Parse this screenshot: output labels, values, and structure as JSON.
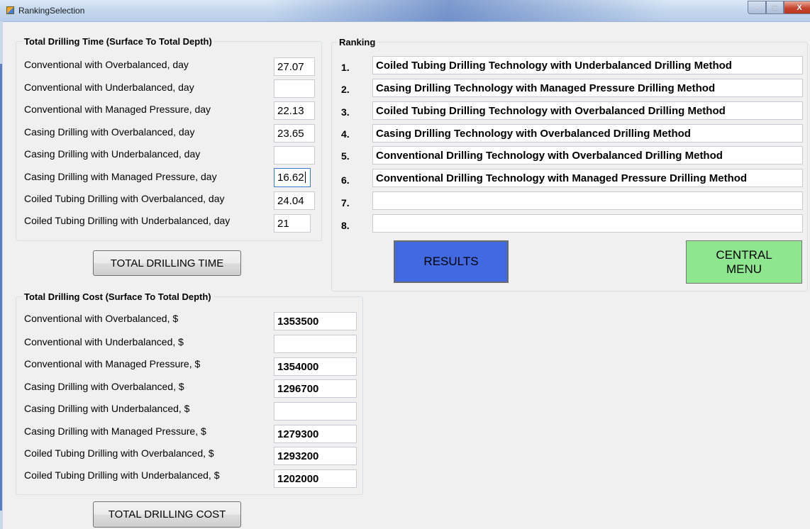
{
  "window": {
    "title": "RankingSelection",
    "minimize_glyph": "–",
    "maximize_glyph": "□",
    "close_glyph": "X"
  },
  "time_group": {
    "title": "Total Drilling Time (Surface To Total Depth)",
    "rows": [
      {
        "label": "Conventional with Overbalanced, day",
        "value": "27.07"
      },
      {
        "label": "Conventional with Underbalanced, day",
        "value": ""
      },
      {
        "label": "Conventional with Managed Pressure, day",
        "value": "22.13"
      },
      {
        "label": "Casing Drilling with Overbalanced, day",
        "value": "23.65"
      },
      {
        "label": "Casing Drilling with Underbalanced, day",
        "value": ""
      },
      {
        "label": "Casing Drilling with Managed Pressure, day",
        "value": "16.62"
      },
      {
        "label": "Coiled Tubing Drilling with Overbalanced, day",
        "value": "24.04"
      },
      {
        "label": "Coiled Tubing Drilling with Underbalanced, day",
        "value": "21"
      }
    ],
    "button_label": "TOTAL DRILLING TIME"
  },
  "cost_group": {
    "title": "Total Drilling Cost (Surface To Total Depth)",
    "rows": [
      {
        "label": "Conventional with Overbalanced, $",
        "value": "1353500"
      },
      {
        "label": "Conventional with Underbalanced, $",
        "value": ""
      },
      {
        "label": "Conventional with Managed Pressure, $",
        "value": "1354000"
      },
      {
        "label": "Casing Drilling with Overbalanced, $",
        "value": "1296700"
      },
      {
        "label": "Casing Drilling with Underbalanced, $",
        "value": ""
      },
      {
        "label": "Casing Drilling with Managed Pressure, $",
        "value": "1279300"
      },
      {
        "label": "Coiled Tubing Drilling with Overbalanced, $",
        "value": "1293200"
      },
      {
        "label": "Coiled Tubing Drilling with Underbalanced, $",
        "value": "1202000"
      }
    ],
    "button_label": "TOTAL DRILLING COST"
  },
  "ranking_group": {
    "title": "Ranking",
    "items": [
      {
        "number": "1.",
        "value": "Coiled Tubing Drilling Technology with Underbalanced Drilling Method"
      },
      {
        "number": "2.",
        "value": "Casing Drilling Technology with Managed Pressure Drilling Method"
      },
      {
        "number": "3.",
        "value": "Coiled Tubing Drilling Technology with Overbalanced Drilling Method"
      },
      {
        "number": "4.",
        "value": "Casing Drilling Technology with Overbalanced Drilling Method"
      },
      {
        "number": "5.",
        "value": "Conventional Drilling Technology with Overbalanced Drilling Method"
      },
      {
        "number": "6.",
        "value": "Conventional Drilling Technology with Managed Pressure Drilling Method"
      },
      {
        "number": "7.",
        "value": ""
      },
      {
        "number": "8.",
        "value": ""
      }
    ],
    "results_label": "RESULTS",
    "central_menu_line1": "CENTRAL",
    "central_menu_line2": "MENU"
  },
  "colors": {
    "results_button": "#4169e1",
    "central_menu_button": "#8ee78e",
    "form_background": "#f0f0f0"
  }
}
